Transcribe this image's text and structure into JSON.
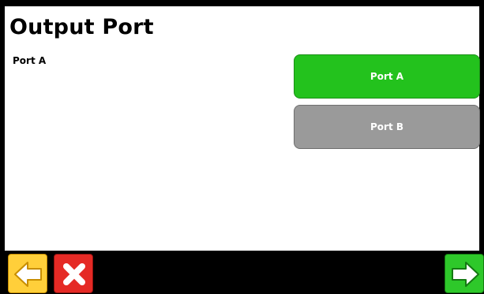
{
  "header": {
    "title": "Output Port"
  },
  "selection": {
    "current": "Port A"
  },
  "options": [
    {
      "label": "Port A",
      "selected": true,
      "color": "#23c21d"
    },
    {
      "label": "Port B",
      "selected": false,
      "color": "#9a9a9a"
    }
  ],
  "footer": {
    "back_icon": "arrow-left-icon",
    "cancel_icon": "close-icon",
    "next_icon": "arrow-right-icon",
    "colors": {
      "back": "#ffcf3a",
      "cancel": "#e52a25",
      "next": "#2ec82a"
    }
  }
}
